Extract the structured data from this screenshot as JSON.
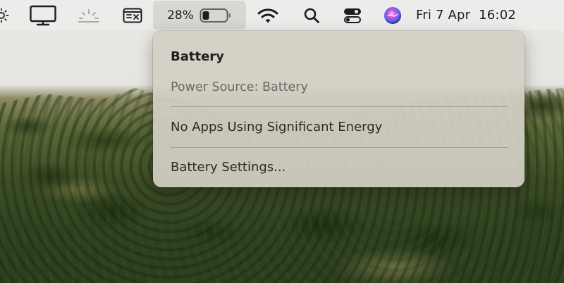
{
  "menubar": {
    "icons": {
      "brightness": "sun-icon",
      "display": "display-monitor-icon",
      "night_shift": "dimmed-sun-icon",
      "screen_share": "screen-mirroring-icon",
      "wifi": "wifi-icon",
      "search": "spotlight-search-icon",
      "control_center": "control-center-icon",
      "siri": "siri-icon"
    },
    "battery": {
      "percentage": "28%",
      "level": 0.28
    },
    "clock": "Fri 7 Apr  16:02"
  },
  "battery_menu": {
    "title": "Battery",
    "power_source": "Power Source: Battery",
    "energy_status": "No Apps Using Significant Energy",
    "settings_label": "Battery Settings..."
  },
  "colors": {
    "menubar_bg": "#edecea",
    "menu_bg": "#d2d0c4",
    "text_primary": "#1f1f1e",
    "text_secondary": "#6a6963"
  }
}
